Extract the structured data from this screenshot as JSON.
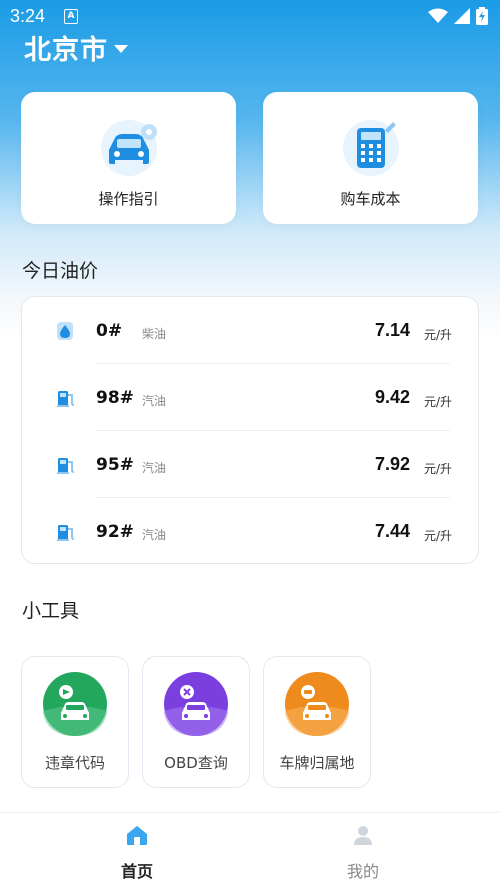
{
  "status_bar": {
    "time": "3:24",
    "notif": "A"
  },
  "header": {
    "city": "北京市"
  },
  "shortcuts": [
    {
      "label": "操作指引",
      "icon": "car-guide-icon"
    },
    {
      "label": "购车成本",
      "icon": "calculator-icon"
    }
  ],
  "oil_section": {
    "title": "今日油价",
    "rows": [
      {
        "grade": "0#",
        "type": "柴油",
        "price": "7.14",
        "unit": "元/升",
        "icon": "oil-drop-icon"
      },
      {
        "grade": "98#",
        "type": "汽油",
        "price": "9.42",
        "unit": "元/升",
        "icon": "fuel-pump-icon"
      },
      {
        "grade": "95#",
        "type": "汽油",
        "price": "7.92",
        "unit": "元/升",
        "icon": "fuel-pump-icon"
      },
      {
        "grade": "92#",
        "type": "汽油",
        "price": "7.44",
        "unit": "元/升",
        "icon": "fuel-pump-icon"
      }
    ]
  },
  "tools_section": {
    "title": "小工具",
    "items": [
      {
        "label": "违章代码",
        "icon": "violation-code-icon",
        "color": "#22a75d"
      },
      {
        "label": "OBD查询",
        "icon": "obd-query-icon",
        "color": "#7b3fe0"
      },
      {
        "label": "车牌归属地",
        "icon": "plate-location-icon",
        "color": "#ef8a1c"
      }
    ]
  },
  "tab_bar": {
    "tabs": [
      {
        "label": "首页",
        "active": true,
        "icon": "home-icon"
      },
      {
        "label": "我的",
        "active": false,
        "icon": "profile-icon"
      }
    ]
  },
  "colors": {
    "primary": "#1a9be6",
    "text": "#222222",
    "muted": "#888888"
  }
}
